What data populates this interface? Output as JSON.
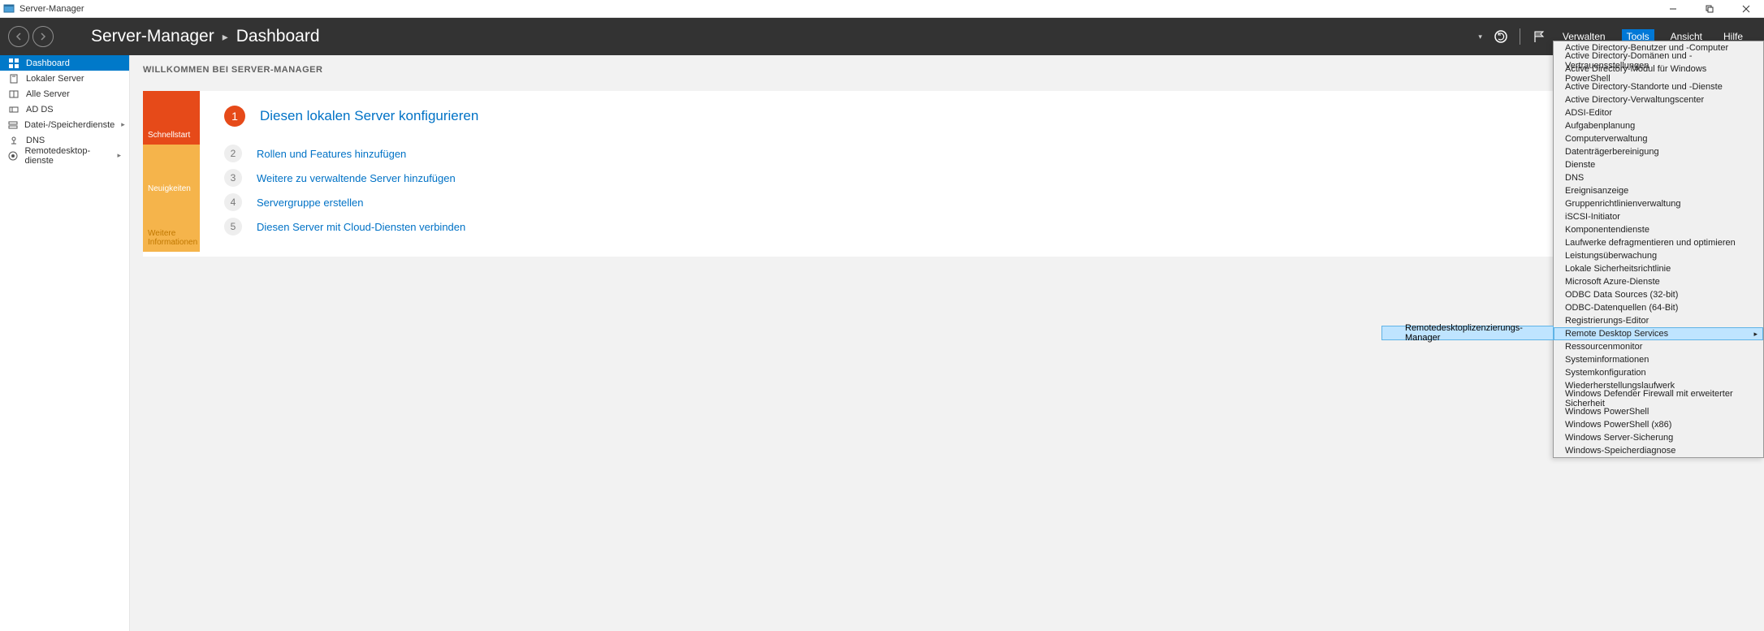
{
  "app": {
    "title": "Server-Manager"
  },
  "header": {
    "breadcrumb_app": "Server-Manager",
    "breadcrumb_page": "Dashboard",
    "menu": {
      "verwalten": "Verwalten",
      "tools": "Tools",
      "ansicht": "Ansicht",
      "hilfe": "Hilfe"
    }
  },
  "sidebar": {
    "items": [
      {
        "label": "Dashboard"
      },
      {
        "label": "Lokaler Server"
      },
      {
        "label": "Alle Server"
      },
      {
        "label": "AD DS"
      },
      {
        "label": "Datei-/Speicherdienste"
      },
      {
        "label": "DNS"
      },
      {
        "label": "Remotedesktop- dienste"
      }
    ]
  },
  "content": {
    "heading": "WILLKOMMEN BEI SERVER-MANAGER",
    "tabs": {
      "quick": "Schnellstart",
      "news": "Neuigkeiten",
      "more": "Weitere Informationen"
    },
    "steps": [
      {
        "n": "1",
        "label": "Diesen lokalen Server konfigurieren"
      },
      {
        "n": "2",
        "label": "Rollen und Features hinzufügen"
      },
      {
        "n": "3",
        "label": "Weitere zu verwaltende Server hinzufügen"
      },
      {
        "n": "4",
        "label": "Servergruppe erstellen"
      },
      {
        "n": "5",
        "label": "Diesen Server mit Cloud-Diensten verbinden"
      }
    ]
  },
  "tools_menu": [
    "Active Directory-Benutzer und -Computer",
    "Active Directory-Domänen und -Vertrauensstellungen",
    "Active Directory-Modul für Windows PowerShell",
    "Active Directory-Standorte und -Dienste",
    "Active Directory-Verwaltungscenter",
    "ADSI-Editor",
    "Aufgabenplanung",
    "Computerverwaltung",
    "Datenträgerbereinigung",
    "Dienste",
    "DNS",
    "Ereignisanzeige",
    "Gruppenrichtlinienverwaltung",
    "iSCSI-Initiator",
    "Komponentendienste",
    "Laufwerke defragmentieren und optimieren",
    "Leistungsüberwachung",
    "Lokale Sicherheitsrichtlinie",
    "Microsoft Azure-Dienste",
    "ODBC Data Sources (32-bit)",
    "ODBC-Datenquellen (64-Bit)",
    "Registrierungs-Editor",
    "Remote Desktop Services",
    "Ressourcenmonitor",
    "Systeminformationen",
    "Systemkonfiguration",
    "Wiederherstellungslaufwerk",
    "Windows Defender Firewall mit erweiterter Sicherheit",
    "Windows PowerShell",
    "Windows PowerShell (x86)",
    "Windows Server-Sicherung",
    "Windows-Speicherdiagnose"
  ],
  "submenu": {
    "item": "Remotedesktoplizenzierungs-Manager"
  }
}
